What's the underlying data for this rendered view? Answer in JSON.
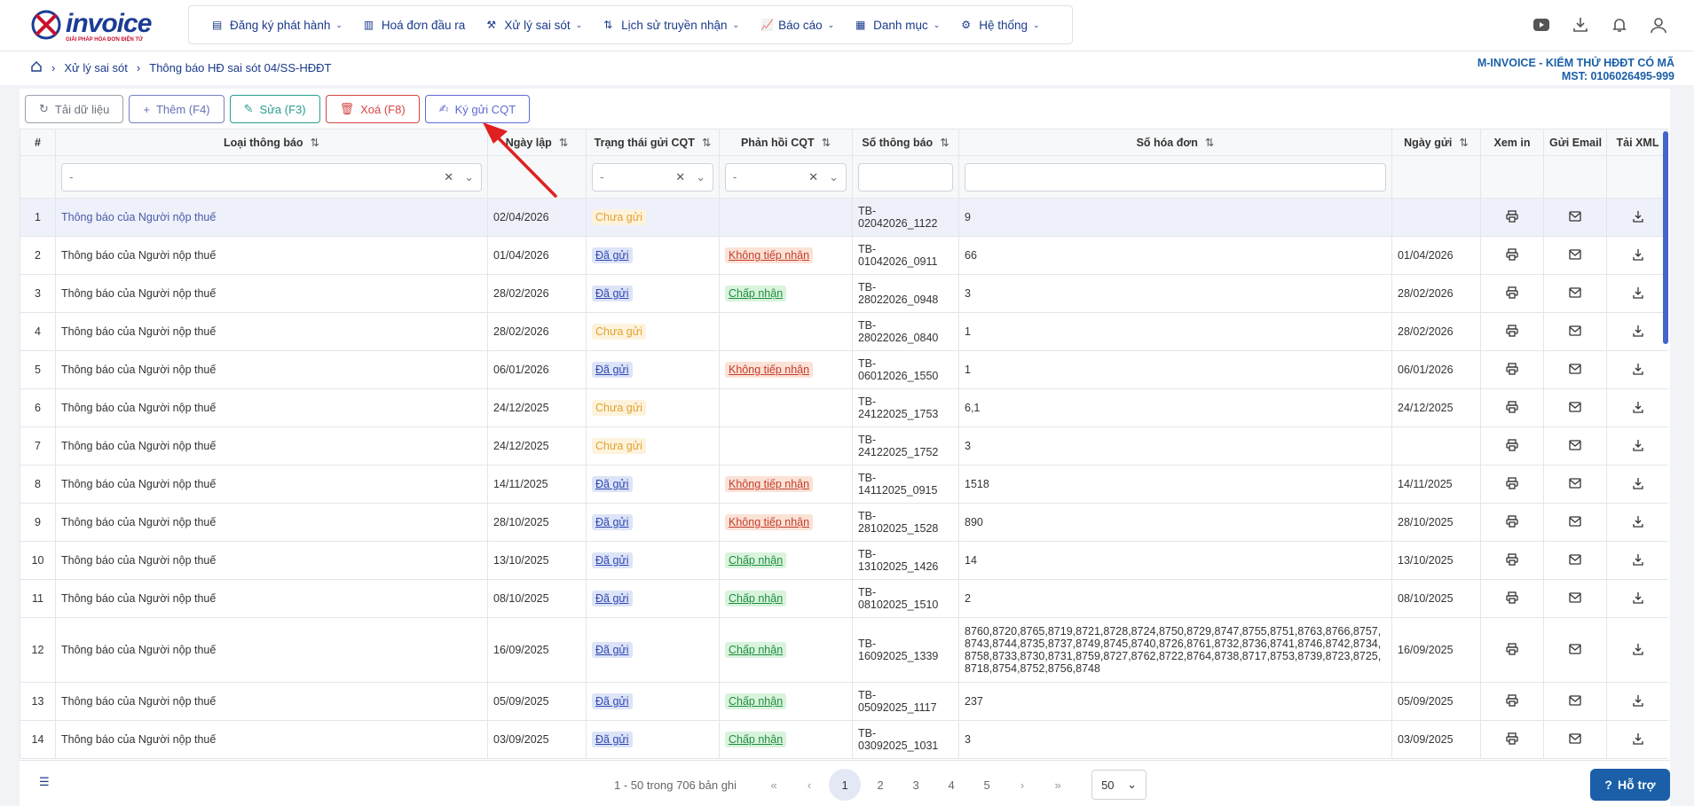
{
  "logo": {
    "brand": "invoice",
    "tagline": "GIẢI PHÁP HÓA ĐƠN ĐIỆN TỬ"
  },
  "menu": [
    {
      "label": "Đăng ký phát hành",
      "icon": "document-icon",
      "dropdown": true
    },
    {
      "label": "Hoá đơn đầu ra",
      "icon": "invoice-icon",
      "dropdown": false
    },
    {
      "label": "Xử lý sai sót",
      "icon": "fix-icon",
      "dropdown": true
    },
    {
      "label": "Lịch sử truyền nhận",
      "icon": "transfer-icon",
      "dropdown": true
    },
    {
      "label": "Báo cáo",
      "icon": "chart-icon",
      "dropdown": true
    },
    {
      "label": "Danh mục",
      "icon": "grid-icon",
      "dropdown": true
    },
    {
      "label": "Hệ thống",
      "icon": "gear-icon",
      "dropdown": true
    }
  ],
  "breadcrumb": {
    "level1": "Xử lý sai sót",
    "level2": "Thông báo HĐ sai sót 04/SS-HĐĐT"
  },
  "company": {
    "name": "M-INVOICE - KIỂM THỬ HĐĐT CÓ MÃ",
    "tax": "MST: 0106026495-999"
  },
  "toolbar": {
    "load": "Tải dữ liệu",
    "add": "Thêm (F4)",
    "edit": "Sửa (F3)",
    "delete": "Xoá (F8)",
    "sign": "Ký gửi CQT"
  },
  "columns": {
    "num": "#",
    "type": "Loại thông báo",
    "date": "Ngày lập",
    "status": "Trạng thái gửi CQT",
    "reply": "Phản hồi CQT",
    "code": "Số thông báo",
    "inv": "Số hóa đơn",
    "sent": "Ngày gửi",
    "view": "Xem in",
    "email": "Gửi Email",
    "xml": "Tải XML"
  },
  "filters": {
    "type": "-",
    "status": "-",
    "reply": "-"
  },
  "rows": [
    {
      "num": "1",
      "type": "Thông báo của Người nộp thuế",
      "date": "02/04/2026",
      "status": "Chưa gửi",
      "reply": "",
      "code": "TB-02042026_1122",
      "inv": "9",
      "sent": ""
    },
    {
      "num": "2",
      "type": "Thông báo của Người nộp thuế",
      "date": "01/04/2026",
      "status": "Đã gửi",
      "reply": "Không tiếp nhận",
      "code": "TB-01042026_0911",
      "inv": "66",
      "sent": "01/04/2026"
    },
    {
      "num": "3",
      "type": "Thông báo của Người nộp thuế",
      "date": "28/02/2026",
      "status": "Đã gửi",
      "reply": "Chấp nhận",
      "code": "TB-28022026_0948",
      "inv": "3",
      "sent": "28/02/2026"
    },
    {
      "num": "4",
      "type": "Thông báo của Người nộp thuế",
      "date": "28/02/2026",
      "status": "Chưa gửi",
      "reply": "",
      "code": "TB-28022026_0840",
      "inv": "1",
      "sent": "28/02/2026"
    },
    {
      "num": "5",
      "type": "Thông báo của Người nộp thuế",
      "date": "06/01/2026",
      "status": "Đã gửi",
      "reply": "Không tiếp nhận",
      "code": "TB-06012026_1550",
      "inv": "1",
      "sent": "06/01/2026"
    },
    {
      "num": "6",
      "type": "Thông báo của Người nộp thuế",
      "date": "24/12/2025",
      "status": "Chưa gửi",
      "reply": "",
      "code": "TB-24122025_1753",
      "inv": "6,1",
      "sent": "24/12/2025"
    },
    {
      "num": "7",
      "type": "Thông báo của Người nộp thuế",
      "date": "24/12/2025",
      "status": "Chưa gửi",
      "reply": "",
      "code": "TB-24122025_1752",
      "inv": "3",
      "sent": ""
    },
    {
      "num": "8",
      "type": "Thông báo của Người nộp thuế",
      "date": "14/11/2025",
      "status": "Đã gửi",
      "reply": "Không tiếp nhận",
      "code": "TB-14112025_0915",
      "inv": "1518",
      "sent": "14/11/2025"
    },
    {
      "num": "9",
      "type": "Thông báo của Người nộp thuế",
      "date": "28/10/2025",
      "status": "Đã gửi",
      "reply": "Không tiếp nhận",
      "code": "TB-28102025_1528",
      "inv": "890",
      "sent": "28/10/2025"
    },
    {
      "num": "10",
      "type": "Thông báo của Người nộp thuế",
      "date": "13/10/2025",
      "status": "Đã gửi",
      "reply": "Chấp nhận",
      "code": "TB-13102025_1426",
      "inv": "14",
      "sent": "13/10/2025"
    },
    {
      "num": "11",
      "type": "Thông báo của Người nộp thuế",
      "date": "08/10/2025",
      "status": "Đã gửi",
      "reply": "Chấp nhận",
      "code": "TB-08102025_1510",
      "inv": "2",
      "sent": "08/10/2025"
    },
    {
      "num": "12",
      "type": "Thông báo của Người nộp thuế",
      "date": "16/09/2025",
      "status": "Đã gửi",
      "reply": "Chấp nhận",
      "code": "TB-16092025_1339",
      "inv": "8760,8720,8765,8719,8721,8728,8724,8750,8729,8747,8755,8751,8763,8766,8757,8743,8744,8735,8737,8749,8745,8740,8726,8761,8732,8736,8741,8746,8742,8734,8758,8733,8730,8731,8759,8727,8762,8722,8764,8738,8717,8753,8739,8723,8725,8718,8754,8752,8756,8748",
      "sent": "16/09/2025"
    },
    {
      "num": "13",
      "type": "Thông báo của Người nộp thuế",
      "date": "05/09/2025",
      "status": "Đã gửi",
      "reply": "Chấp nhận",
      "code": "TB-05092025_1117",
      "inv": "237",
      "sent": "05/09/2025"
    },
    {
      "num": "14",
      "type": "Thông báo của Người nộp thuế",
      "date": "03/09/2025",
      "status": "Đã gửi",
      "reply": "Chấp nhận",
      "code": "TB-03092025_1031",
      "inv": "3",
      "sent": "03/09/2025"
    }
  ],
  "pager": {
    "info": "1 - 50 trong 706 bản ghi",
    "pages": [
      "1",
      "2",
      "3",
      "4",
      "5"
    ],
    "size": "50"
  },
  "help": "Hỗ trợ",
  "colors": {
    "primary": "#1a3a8a",
    "accent": "#1a5fa8",
    "arrow": "#e02020"
  }
}
